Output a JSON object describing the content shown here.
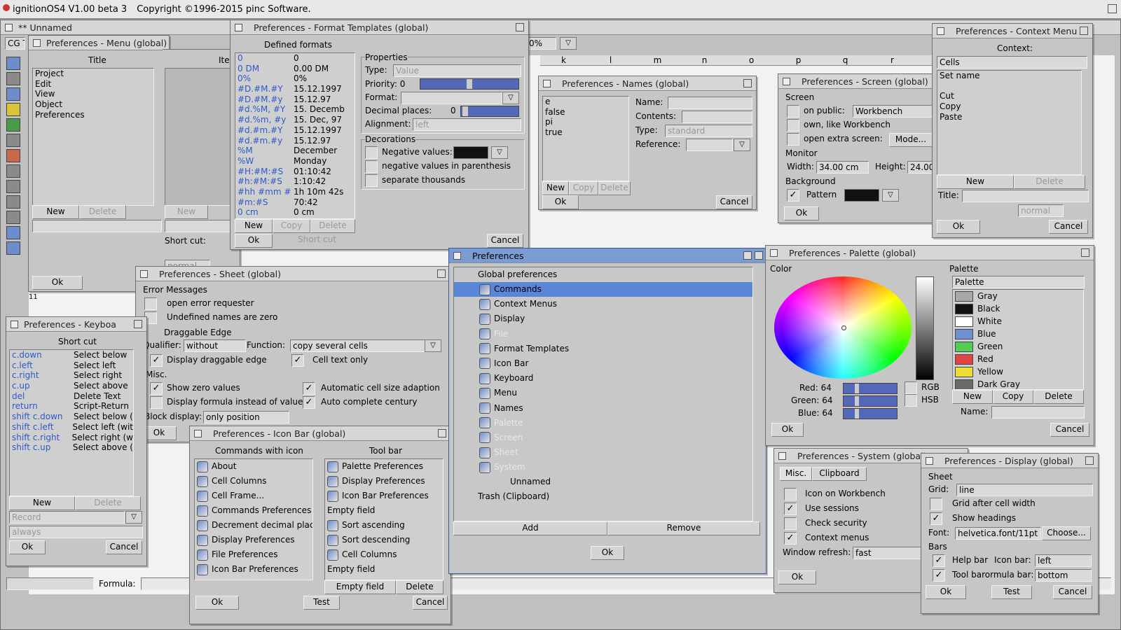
{
  "screen": {
    "title": "ignitionOS4  V1.00 beta 3",
    "copyright": "Copyright ©1996-2015 pinc Software."
  },
  "doc": {
    "title": "** Unnamed",
    "cell_ref": "CG T",
    "zoom": "0%",
    "formula_label": "Formula:",
    "columns": [
      "k",
      "l",
      "m",
      "n",
      "o",
      "p",
      "q",
      "r",
      "s"
    ],
    "rownum": "11"
  },
  "menu_win": {
    "title": "Preferences - Menu  (global)",
    "col_title": "Title",
    "col_items": "Ite",
    "items": [
      "Project",
      "Edit",
      "View",
      "Object",
      "Preferences"
    ],
    "new": "New",
    "delete": "Delete",
    "new2": "New",
    "ok": "Ok",
    "shortcut_label": "Short cut:",
    "normal": "normal"
  },
  "format_win": {
    "title": "Preferences - Format Templates  (global)",
    "defined": "Defined formats",
    "formats": [
      [
        "0",
        "0"
      ],
      [
        "0 DM",
        "0.00 DM"
      ],
      [
        "0%",
        "0%"
      ],
      [
        "#D.#M.#Y",
        "15.12.1997"
      ],
      [
        "#D.#M.#y",
        "15.12.97"
      ],
      [
        "#d.%M, #Y",
        "15. Decemb"
      ],
      [
        "#d.%m, #y",
        "15. Dec, 97"
      ],
      [
        "#d.#m.#Y",
        "15.12.1997"
      ],
      [
        "#d.#m.#y",
        "15.12.97"
      ],
      [
        "%M",
        "December"
      ],
      [
        "%W",
        "Monday"
      ],
      [
        "#H:#M:#S",
        "01:10:42"
      ],
      [
        "#h:#M:#S",
        "1:10:42"
      ],
      [
        "#hh #mm #",
        "1h 10m 42s"
      ],
      [
        "#m:#S",
        "70:42"
      ],
      [
        "0 cm",
        "0 cm"
      ]
    ],
    "properties": "Properties",
    "type_label": "Type:",
    "type_val": "Value",
    "priority_label": "Priority: 0",
    "format_label": "Format:",
    "decimal_label": "Decimal places:",
    "decimal_val": "0",
    "alignment_label": "Alignment:",
    "alignment_val": "left",
    "decorations": "Decorations",
    "neg_label": "Negative values:",
    "neg_paren": "negative values in parenthesis",
    "sep_thousands": "separate thousands",
    "new": "New",
    "copy": "Copy",
    "delete": "Delete",
    "ok": "Ok",
    "cancel": "Cancel",
    "shortcut_ghost": "Short cut"
  },
  "names_win": {
    "title": "Preferences - Names  (global)",
    "items": [
      "e",
      "false",
      "pi",
      "true"
    ],
    "name_label": "Name:",
    "contents_label": "Contents:",
    "type_label": "Type:",
    "type_val": "standard",
    "reference_label": "Reference:",
    "new": "New",
    "copy": "Copy",
    "delete": "Delete",
    "ok": "Ok",
    "cancel": "Cancel"
  },
  "screen_win": {
    "title": "Preferences - Screen  (global)",
    "screen": "Screen",
    "on_public": "on public:",
    "public_val": "Workbench",
    "own_like": "own, like Workbench",
    "open_extra": "open extra screen:",
    "mode": "Mode...",
    "monitor": "Monitor",
    "width_label": "Width:",
    "width_val": "34.00 cm",
    "height_label": "Height:",
    "height_val": "24.00",
    "background": "Background",
    "pattern": "Pattern",
    "ok": "Ok",
    "font_ghost": "Font"
  },
  "context_win": {
    "title": "Preferences - Context Menu",
    "context_label": "Context:",
    "context_val": "Cells",
    "items": [
      "Set name",
      "",
      "Cut",
      "Copy",
      "Paste"
    ],
    "new": "New",
    "delete": "Delete",
    "title_label": "Title:",
    "normal": "normal",
    "ok": "Ok",
    "cancel": "Cancel"
  },
  "sheet_win": {
    "title": "Preferences - Sheet  (global)",
    "error_messages": "Error Messages",
    "open_error": "open error requester",
    "undefined_zero": "Undefined names are zero",
    "draggable": "Draggable Edge",
    "qualifier_label": "Qualifier:",
    "qualifier_val": "without",
    "function_label": "Function:",
    "function_val": "copy several cells",
    "display_drag": "Display draggable edge",
    "cell_text_only": "Cell text only",
    "misc": "Misc.",
    "show_zero": "Show zero values",
    "auto_cell_size": "Automatic cell size adaption",
    "display_formula": "Display formula instead of values",
    "auto_century": "Auto complete century",
    "block_label": "Block display:",
    "block_val": "only position",
    "ok": "Ok",
    "cancel": "Cancel"
  },
  "keyboard_win": {
    "title": "Preferences - Keyboa",
    "shortcut": "Short cut",
    "rows": [
      [
        "c.down",
        "Select below"
      ],
      [
        "c.left",
        "Select left"
      ],
      [
        "c.right",
        "Select right"
      ],
      [
        "c.up",
        "Select above"
      ],
      [
        "del",
        "Delete Text"
      ],
      [
        "return",
        "Script-Return"
      ],
      [
        "shift c.down",
        "Select below ("
      ],
      [
        "shift c.left",
        "Select left (wit"
      ],
      [
        "shift c.right",
        "Select right (w"
      ],
      [
        "shift c.up",
        "Select above ("
      ]
    ],
    "new": "New",
    "delete": "Delete",
    "record": "Record",
    "always": "always",
    "ok": "Ok",
    "cancel": "Cancel"
  },
  "iconbar_win": {
    "title": "Preferences - Icon Bar  (global)",
    "col_commands": "Commands with icon",
    "col_toolbar": "Tool bar",
    "commands": [
      "About",
      "Cell Columns",
      "Cell Frame...",
      "Commands Preferences",
      "Decrement decimal plac",
      "Display Preferences",
      "File Preferences",
      "Icon Bar Preferences"
    ],
    "toolbar": [
      "Palette Preferences",
      "Display Preferences",
      "Icon Bar Preferences",
      "Empty field",
      "Sort ascending",
      "Sort descending",
      "Cell Columns",
      "Empty field"
    ],
    "empty_field": "Empty field",
    "delete": "Delete",
    "ok": "Ok",
    "test": "Test",
    "cancel": "Cancel"
  },
  "prefs_win": {
    "title": "Preferences",
    "global": "Global preferences",
    "items": [
      "Commands",
      "Context Menus",
      "Display",
      "File",
      "Format Templates",
      "Icon Bar",
      "Keyboard",
      "Menu",
      "Names",
      "Palette",
      "Screen",
      "Sheet",
      "System"
    ],
    "unnamed": "Unnamed",
    "trash": "Trash (Clipboard)",
    "add": "Add",
    "remove": "Remove",
    "ok": "Ok"
  },
  "palette_win": {
    "title": "Preferences - Palette  (global)",
    "color": "Color",
    "palette_group": "Palette",
    "palette_popup": "Palette",
    "colors": [
      {
        "name": "Gray",
        "hex": "#a8a8a8"
      },
      {
        "name": "Black",
        "hex": "#111111"
      },
      {
        "name": "White",
        "hex": "#ffffff"
      },
      {
        "name": "Blue",
        "hex": "#6f8fd0"
      },
      {
        "name": "Green",
        "hex": "#55cc55"
      },
      {
        "name": "Red",
        "hex": "#dd4444"
      },
      {
        "name": "Yellow",
        "hex": "#eedd33"
      },
      {
        "name": "Dark Gray",
        "hex": "#6a6a6a"
      }
    ],
    "red": "Red: 64",
    "green": "Green: 64",
    "blue": "Blue: 64",
    "rgb": "RGB",
    "hsb": "HSB",
    "new": "New",
    "copy": "Copy",
    "delete": "Delete",
    "name_label": "Name:",
    "ok": "Ok",
    "cancel": "Cancel"
  },
  "system_win": {
    "title": "Preferences - System  (global)",
    "tab_misc": "Misc.",
    "tab_clipboard": "Clipboard",
    "icon_wb": "Icon on Workbench",
    "use_sessions": "Use sessions",
    "check_security": "Check security",
    "context_menus": "Context menus",
    "refresh_label": "Window refresh:",
    "refresh_val": "fast",
    "ok": "Ok"
  },
  "display_win": {
    "title": "Preferences - Display  (global)",
    "sheet": "Sheet",
    "grid_label": "Grid:",
    "grid_val": "line",
    "grid_after": "Grid after cell width",
    "show_headings": "Show headings",
    "font_label": "Font:",
    "font_val": "helvetica.font/11pt",
    "choose": "Choose...",
    "bars": "Bars",
    "help_bar": "Help bar",
    "icon_bar_label": "Icon bar:",
    "icon_bar_val": "left",
    "tool_bar": "Tool barormula bar:",
    "tool_bar_val": "bottom",
    "ok": "Ok",
    "test": "Test",
    "cancel": "Cancel"
  }
}
